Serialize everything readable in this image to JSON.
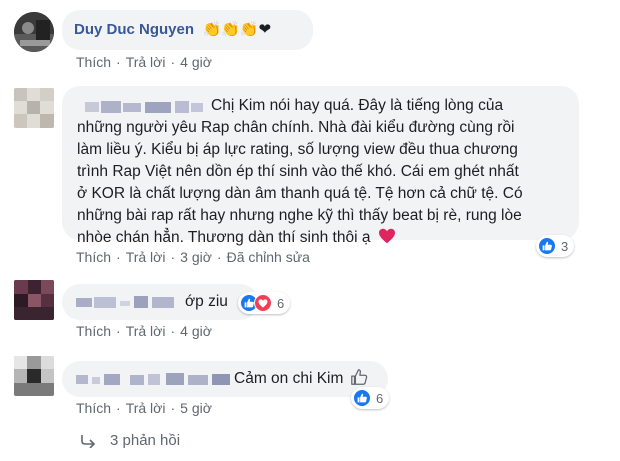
{
  "comments": [
    {
      "author": "Duy Duc Nguyen",
      "emoji_trailer": "👏👏👏❤",
      "actions": {
        "like": "Thích",
        "reply": "Trả lời",
        "time": "4 giờ"
      }
    },
    {
      "text": "Chị Kim nói hay quá. Đây là tiếng lòng của những người yêu Rap chân chính. Nhà đài kiểu đường cùng rồi làm liều ý. Kiểu bị áp lực rating, số lượng view đều thua chương trình Rap Việt nên dồn ép thí sinh vào thế khó. Cái em ghét nhất ở KOR là chất lượng dàn âm thanh quá tệ. Tệ hơn cả chữ tệ. Có những bài rap rất hay nhưng nghe kỹ thì thấy beat bị rè, rung lòe nhòe chán hẳn. Thương dàn thí sinh thôi ạ",
      "lines": [
        "Chị Kim nói hay quá. Đây là tiếng lòng của",
        "những người yêu Rap chân chính. Nhà đài kiểu đường cùng rồi",
        "làm liều ý. Kiểu bị áp lực rating, số lượng view đều thua chương",
        "trình Rap Việt nên dồn ép thí sinh vào thế khó. Cái em ghét nhất",
        "ở KOR là chất lượng dàn âm thanh quá tệ. Tệ hơn cả chữ tệ. Có",
        "những bài rap rất hay nhưng nghe kỹ thì thấy beat bị rè, rung lòe",
        "nhòe chán hẳn. Thương dàn thí sinh thôi ạ"
      ],
      "reaction_count": "3",
      "actions": {
        "like": "Thích",
        "reply": "Trả lời",
        "time": "3 giờ",
        "edited": "Đã chỉnh sửa"
      }
    },
    {
      "text": "ớp ziu",
      "reaction_count": "6",
      "actions": {
        "like": "Thích",
        "reply": "Trả lời",
        "time": "4 giờ"
      }
    },
    {
      "text": "Cảm on chi Kim",
      "reaction_count": "6",
      "actions": {
        "like": "Thích",
        "reply": "Trả lời",
        "time": "5 giờ"
      }
    }
  ],
  "replies_label": "3 phản hồi",
  "colors": {
    "name": "#385898",
    "bubble": "#f2f3f5",
    "meta": "#606770",
    "like": "#1877f2",
    "love": "#f33e58"
  }
}
